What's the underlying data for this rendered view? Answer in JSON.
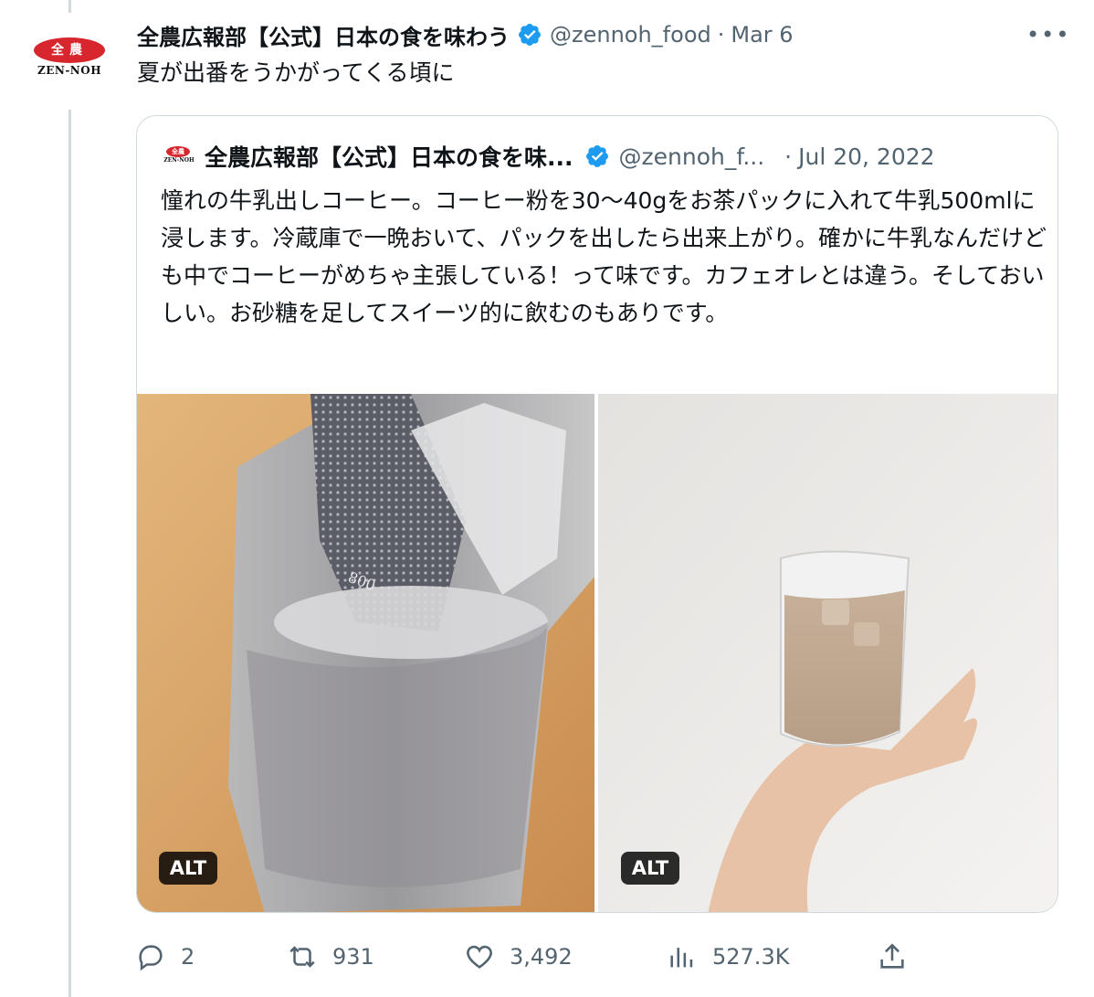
{
  "tweet": {
    "display_name": "全農広報部【公式】日本の食を味わう",
    "handle": "@zennoh_food",
    "separator": "·",
    "date": "Mar 6",
    "text": "夏が出番をうかがってくる頃に",
    "more_label": "•••",
    "avatar": {
      "mark": "全農",
      "brand": "ZEN-NOH"
    }
  },
  "quote": {
    "display_name": "全農広報部【公式】日本の食を味...",
    "handle": "@zennoh_f...",
    "separator": "·",
    "date": "Jul 20, 2022",
    "text": "憧れの牛乳出しコーヒー。コーヒー粉を30〜40gをお茶パックに入れて牛乳500mlに浸します。冷蔵庫で一晩おいて、パックを出したら出来上がり。確かに牛乳なんだけども中でコーヒーがめちゃ主張している！って味です。カフェオレとは違う。そしておいしい。お砂糖を足してスイーツ的に飲むのもありです。",
    "avatar": {
      "mark": "全農",
      "brand": "ZEN-NOH"
    },
    "media": [
      {
        "alt_label": "ALT",
        "measure_text": "800"
      },
      {
        "alt_label": "ALT"
      }
    ]
  },
  "actions": {
    "replies": "2",
    "retweets": "931",
    "likes": "3,492",
    "views": "527.3K"
  },
  "colors": {
    "accent_verified": "#1d9bf0",
    "secondary_text": "#536471",
    "border": "#cfd9de",
    "brand_red": "#d8262f"
  }
}
